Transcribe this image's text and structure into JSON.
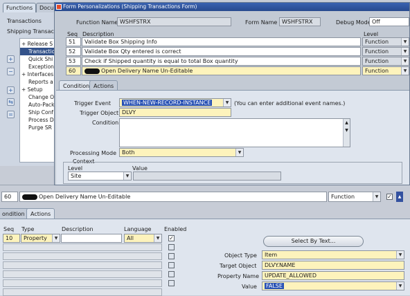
{
  "navigator": {
    "tabs": [
      "Functions",
      "Docu"
    ],
    "items": [
      "Transactions",
      "Shipping Transacti"
    ],
    "tree": [
      "+ Release S",
      "Transactio",
      "Quick Shi",
      "Exception",
      "+ Interfaces",
      "Reports a",
      "+ Setup",
      "Change O",
      "Auto-Pack",
      "Ship Conf",
      "Process D",
      "Purge SR"
    ]
  },
  "form": {
    "title": "Form Personalizations (Shipping Transactions Form)",
    "function_name_label": "Function Name",
    "function_name": "WSHFSTRX",
    "form_name_label": "Form Name",
    "form_name": "WSHFSTRX",
    "debug_mode_label": "Debug Mode",
    "debug_mode": "Off",
    "col_seq": "Seq",
    "col_description": "Description",
    "col_level": "Level",
    "rows": [
      {
        "seq": "51",
        "desc": "Validate Box Shipping Info",
        "level": "Function"
      },
      {
        "seq": "52",
        "desc": "Validate Box Qty entered is correct",
        "level": "Function"
      },
      {
        "seq": "53",
        "desc": "Check if Shipped quantity is equal to total Box quantity",
        "level": "Function"
      },
      {
        "seq": "60",
        "desc": "Open Delivery Name Un-Editable",
        "level": "Function"
      }
    ],
    "tabs": [
      "Condition",
      "Actions"
    ],
    "trigger_event_label": "Trigger Event",
    "trigger_event": "WHEN-NEW-RECORD-INSTANCE",
    "trigger_hint": "(You can enter additional event names.)",
    "trigger_object_label": "Trigger Object",
    "trigger_object": "DLVY",
    "condition_label": "Condition",
    "processing_mode_label": "Processing Mode",
    "processing_mode": "Both",
    "context_label": "Context",
    "context_level_label": "Level",
    "context_value_label": "Value",
    "context_level": "Site"
  },
  "bottom": {
    "seq": "60",
    "desc": "Open Delivery Name Un-Editable",
    "level": "Function",
    "tabs": [
      "ondition",
      "Actions"
    ],
    "col_seq": "Seq",
    "col_type": "Type",
    "col_description": "Description",
    "col_language": "Language",
    "col_enabled": "Enabled",
    "action_seq": "10",
    "action_type": "Property",
    "action_language": "All",
    "select_by_text": "Select By Text...",
    "object_type_label": "Object Type",
    "object_type": "Item",
    "target_object_label": "Target Object",
    "target_object": "DLVY.NAME",
    "property_name_label": "Property Name",
    "property_name": "UPDATE_ALLOWED",
    "value_label": "Value",
    "value": "FALSE"
  }
}
